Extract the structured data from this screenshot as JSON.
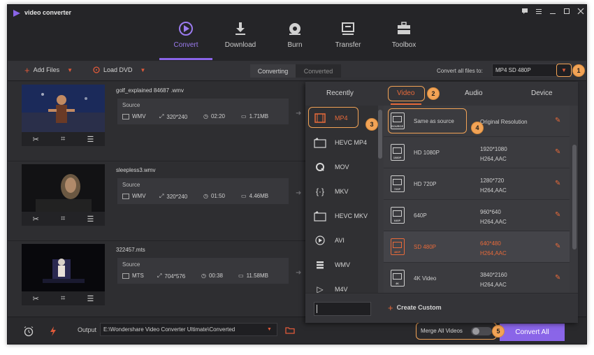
{
  "app": {
    "title": "video converter"
  },
  "window_buttons": [
    "chat-icon",
    "menu-icon",
    "minimize-icon",
    "maximize-icon",
    "close-icon"
  ],
  "nav": {
    "tabs": [
      {
        "label": "Convert",
        "icon": "convert-icon",
        "active": true
      },
      {
        "label": "Download",
        "icon": "download-icon",
        "active": false
      },
      {
        "label": "Burn",
        "icon": "disc-icon",
        "active": false
      },
      {
        "label": "Transfer",
        "icon": "transfer-icon",
        "active": false
      },
      {
        "label": "Toolbox",
        "icon": "toolbox-icon",
        "active": false
      }
    ],
    "accent": "#8a65e8"
  },
  "toolbar": {
    "add_files": "Add Files",
    "load_dvd": "Load DVD",
    "converting": "Converting",
    "converted": "Converted",
    "convert_all_to_label": "Convert all files to:",
    "convert_all_to_value": "MP4 SD 480P"
  },
  "files": [
    {
      "name": "golf_explained 84687 .wmv",
      "source_label": "Source",
      "format": "WMV",
      "resolution": "320*240",
      "duration": "02:20",
      "size": "1.71MB"
    },
    {
      "name": "sleepless3.wmv",
      "source_label": "Source",
      "format": "WMV",
      "resolution": "320*240",
      "duration": "01:50",
      "size": "4.46MB"
    },
    {
      "name": "322457.mts",
      "source_label": "Source",
      "format": "MTS",
      "resolution": "704*576",
      "duration": "00:38",
      "size": "11.58MB"
    }
  ],
  "panel": {
    "tabs": [
      "Recently",
      "Video",
      "Audio",
      "Device"
    ],
    "active_tab": "Video",
    "formats": [
      {
        "label": "MP4",
        "icon": "film-icon",
        "active": true
      },
      {
        "label": "HEVC MP4",
        "icon": "hevc-icon",
        "active": false
      },
      {
        "label": "MOV",
        "icon": "quicktime-icon",
        "active": false
      },
      {
        "label": "MKV",
        "icon": "mkv-icon",
        "active": false
      },
      {
        "label": "HEVC MKV",
        "icon": "hevc-icon",
        "active": false
      },
      {
        "label": "AVI",
        "icon": "play-circle-icon",
        "active": false
      },
      {
        "label": "WMV",
        "icon": "wmv-icon",
        "active": false
      },
      {
        "label": "M4V",
        "icon": "m4v-icon",
        "active": false
      }
    ],
    "resolutions": [
      {
        "name": "Same as source",
        "icon_text": "SOURCE",
        "dim1": "Original Resolution",
        "dim2": "",
        "selected": false,
        "highlight": false
      },
      {
        "name": "HD 1080P",
        "icon_text": "1080P",
        "dim1": "1920*1080",
        "dim2": "H264,AAC",
        "selected": false,
        "highlight": false
      },
      {
        "name": "HD 720P",
        "icon_text": "720P",
        "dim1": "1280*720",
        "dim2": "H264,AAC",
        "selected": false,
        "highlight": false
      },
      {
        "name": "640P",
        "icon_text": "640P",
        "dim1": "960*640",
        "dim2": "H264,AAC",
        "selected": false,
        "highlight": false
      },
      {
        "name": "SD 480P",
        "icon_text": "480P",
        "dim1": "640*480",
        "dim2": "H264,AAC",
        "selected": true,
        "highlight": true
      },
      {
        "name": "4K Video",
        "icon_text": "4K",
        "dim1": "3840*2160",
        "dim2": "H264,AAC",
        "selected": false,
        "highlight": false
      }
    ],
    "search_value": "",
    "create_custom": "Create Custom"
  },
  "bottom": {
    "output_label": "Output",
    "output_path": "E:\\Wondershare Video Converter Ultimate\\Converted",
    "merge_label": "Merge All Videos",
    "merge_on": false,
    "convert_all": "Convert All"
  },
  "callouts": [
    "1",
    "2",
    "3",
    "4",
    "5"
  ],
  "colors": {
    "highlight": "#f2a356",
    "orange": "#e86a3a",
    "purple": "#8a65e8"
  }
}
